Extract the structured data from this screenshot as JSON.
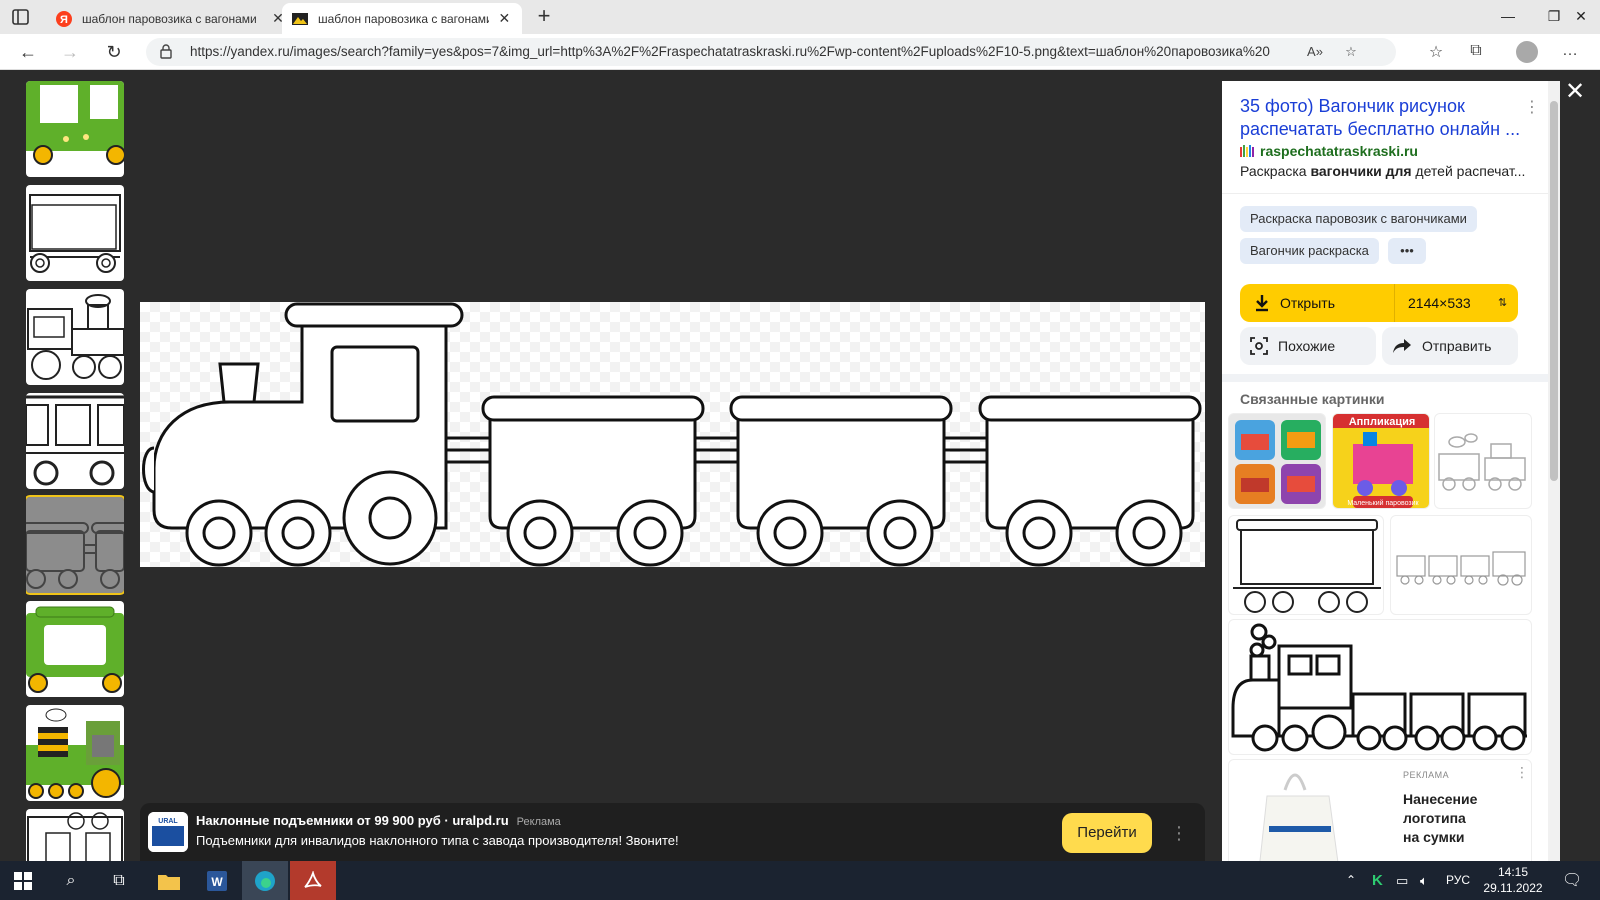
{
  "browser": {
    "tabs": [
      {
        "title": "шаблон паровозика с вагонами",
        "active": false
      },
      {
        "title": "шаблон паровозика с вагонами",
        "active": true
      }
    ],
    "url": "https://yandex.ru/images/search?family=yes&pos=7&img_url=http%3A%2F%2Fraspechatatraskraski.ru%2Fwp-content%2Fuploads%2F10-5.png&text=шаблон%20паровозика%20c..."
  },
  "panel": {
    "title_line1": "35 фото) Вагончик рисунок",
    "title_line2": "распечатать бесплатно онлайн ...",
    "site": "raspechatatraskraski.ru",
    "desc_prefix": "Раскраска ",
    "desc_bold": "вагончики для",
    "desc_suffix": " детей распечат...",
    "chips": [
      "Раскраска паровозик с вагончиками",
      "Вагончик раскраска"
    ],
    "chip_more": "•••",
    "open_label": "Открыть",
    "size_label": "2144×533",
    "similar_label": "Похожие",
    "send_label": "Отправить",
    "related_title": "Связанные картинки",
    "ad_card": {
      "badge": "РЕКЛАМА",
      "text_line1": "Нанесение",
      "text_line2": "логотипа",
      "text_line3": "на сумки"
    },
    "related_images": [
      {
        "caption": "Аппликация"
      },
      {
        "caption": "Маленький паровозик"
      }
    ]
  },
  "ad": {
    "title": "Наклонные подъемники от 99 900 руб · uralpd.ru",
    "tag": "Реклама",
    "text": "Подъемники для инвалидов наклонного типа с завода производителя! Звоните!",
    "button": "Перейти",
    "logo_text": "URAL"
  },
  "taskbar": {
    "lang": "РУС",
    "time": "14:15",
    "date": "29.11.2022"
  }
}
